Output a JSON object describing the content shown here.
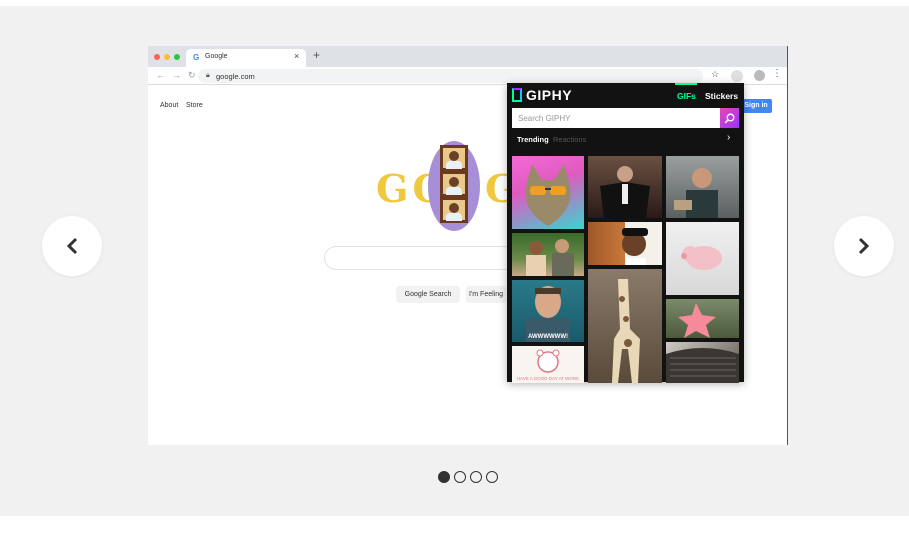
{
  "carousel": {
    "prev_icon": "chevron-left-icon",
    "next_icon": "chevron-right-icon",
    "dots": [
      {
        "active": true
      },
      {
        "active": false
      },
      {
        "active": false
      },
      {
        "active": false
      }
    ]
  },
  "browser": {
    "tab": {
      "favicon": "G",
      "title": "Google",
      "close": "×"
    },
    "new_tab": "+",
    "url": "google.com"
  },
  "google": {
    "links": {
      "about": "About",
      "store": "Store"
    },
    "sign_in": "Sign in",
    "search_button": "Google Search",
    "lucky_button": "I'm Feeling",
    "doodle_left": "GO",
    "doodle_right": "G"
  },
  "giphy": {
    "logo": "GIPHY",
    "tabs": {
      "gifs": "GIFs",
      "stickers": "Stickers"
    },
    "search_placeholder": "Search GIPHY",
    "filters": {
      "trending": "Trending",
      "reactions": "Reactions"
    },
    "gifs": [
      {
        "name": "cat-sunglasses",
        "caption": ""
      },
      {
        "name": "man-in-suit",
        "caption": ""
      },
      {
        "name": "man-eating",
        "caption": ""
      },
      {
        "name": "couple-outdoors",
        "caption": ""
      },
      {
        "name": "man-in-cap",
        "caption": ""
      },
      {
        "name": "pig",
        "caption": ""
      },
      {
        "name": "man-awww",
        "caption": "AWWWWWW!"
      },
      {
        "name": "baby-giraffe",
        "caption": ""
      },
      {
        "name": "patrick-star",
        "caption": ""
      },
      {
        "name": "cute-bear",
        "caption": "HAVE A GOOD DAY AT WORK"
      },
      {
        "name": "cat-in-bag",
        "caption": ""
      }
    ]
  },
  "colors": {
    "giphy_bg": "#121212",
    "giphy_accent": "#00ff99",
    "google_blue": "#4285f4"
  }
}
